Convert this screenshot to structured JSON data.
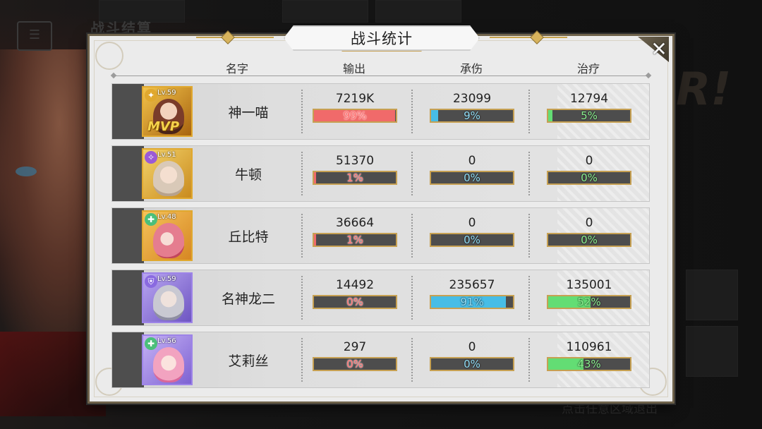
{
  "background": {
    "title": "战斗结算",
    "hint": "点击任意区域退出",
    "logo_fragment": "R!"
  },
  "panel": {
    "title": "战斗统计",
    "close_glyph": "✕"
  },
  "headers": {
    "name": "名字",
    "output": "输出",
    "tank": "承伤",
    "heal": "治疗"
  },
  "rows": [
    {
      "name": "神一喵",
      "level": "Lv.59",
      "mvp": "MVP",
      "role_icon": "attack-role-icon",
      "output": {
        "value": "7219K",
        "percent": "99%",
        "fraction": 0.99
      },
      "tank": {
        "value": "23099",
        "percent": "9%",
        "fraction": 0.09
      },
      "heal": {
        "value": "12794",
        "percent": "5%",
        "fraction": 0.05
      }
    },
    {
      "name": "牛顿",
      "level": "Lv.51",
      "mvp": "",
      "role_icon": "magic-role-icon",
      "output": {
        "value": "51370",
        "percent": "1%",
        "fraction": 0.01
      },
      "tank": {
        "value": "0",
        "percent": "0%",
        "fraction": 0
      },
      "heal": {
        "value": "0",
        "percent": "0%",
        "fraction": 0
      }
    },
    {
      "name": "丘比特",
      "level": "Lv.48",
      "mvp": "",
      "role_icon": "healer-role-icon",
      "output": {
        "value": "36664",
        "percent": "1%",
        "fraction": 0.01
      },
      "tank": {
        "value": "0",
        "percent": "0%",
        "fraction": 0
      },
      "heal": {
        "value": "0",
        "percent": "0%",
        "fraction": 0
      }
    },
    {
      "name": "名神龙二",
      "level": "Lv.59",
      "mvp": "",
      "role_icon": "defense-role-icon",
      "output": {
        "value": "14492",
        "percent": "0%",
        "fraction": 0
      },
      "tank": {
        "value": "235657",
        "percent": "91%",
        "fraction": 0.91
      },
      "heal": {
        "value": "135001",
        "percent": "52%",
        "fraction": 0.52
      }
    },
    {
      "name": "艾莉丝",
      "level": "Lv.56",
      "mvp": "",
      "role_icon": "healer-role-icon",
      "output": {
        "value": "297",
        "percent": "0%",
        "fraction": 0
      },
      "tank": {
        "value": "0",
        "percent": "0%",
        "fraction": 0
      },
      "heal": {
        "value": "110961",
        "percent": "43%",
        "fraction": 0.43
      }
    }
  ],
  "colors": {
    "output_bar": "#f06a6a",
    "tank_bar": "#47bde6",
    "heal_bar": "#63dd74",
    "frame_gold": "#c6a052"
  }
}
